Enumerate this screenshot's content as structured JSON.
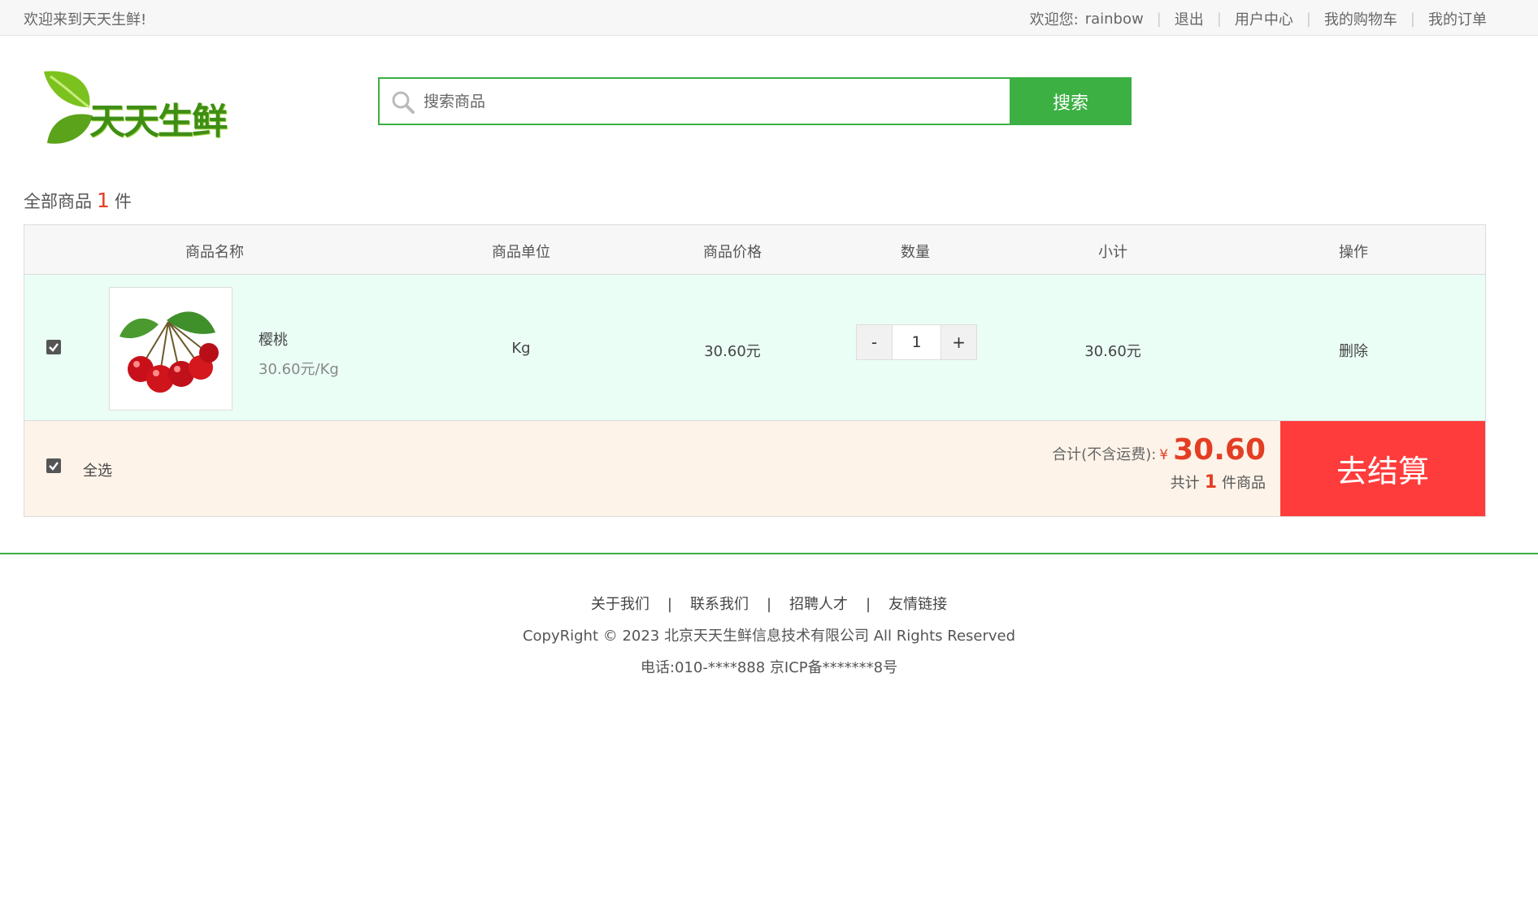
{
  "topbar": {
    "welcome": "欢迎来到天天生鲜!",
    "greeting": "欢迎您:",
    "username": "rainbow",
    "links": {
      "logout": "退出",
      "user_center": "用户中心",
      "cart": "我的购物车",
      "orders": "我的订单"
    }
  },
  "header": {
    "logo_text": "天天生鲜",
    "search_placeholder": "搜索商品",
    "search_button": "搜索"
  },
  "cart": {
    "count_prefix": "全部商品",
    "count": "1",
    "count_suffix": "件",
    "columns": [
      "商品名称",
      "商品单位",
      "商品价格",
      "数量",
      "小计",
      "操作"
    ],
    "items": [
      {
        "checked": true,
        "name": "樱桃",
        "unit_price_text": "30.60元/Kg",
        "unit": "Kg",
        "price": "30.60元",
        "quantity": "1",
        "subtotal": "30.60元",
        "action": "删除"
      }
    ],
    "select_all_label": "全选",
    "total_label": "合计(不含运费):",
    "currency": "¥",
    "total_amount": "30.60",
    "total_count_prefix": "共计",
    "total_count": "1",
    "total_count_suffix": "件商品",
    "checkout_button": "去结算",
    "qty_minus": "-",
    "qty_plus": "+"
  },
  "footer": {
    "links": [
      "关于我们",
      "联系我们",
      "招聘人才",
      "友情链接"
    ],
    "separator": "|",
    "copyright": "CopyRight © 2023 北京天天生鲜信息技术有限公司 All Rights Reserved",
    "tel": "电话:010-****888 京ICP备*******8号"
  },
  "colors": {
    "brand_green": "#3cb043",
    "accent_red": "#e33e24",
    "checkout_red": "#ff3c3c"
  }
}
